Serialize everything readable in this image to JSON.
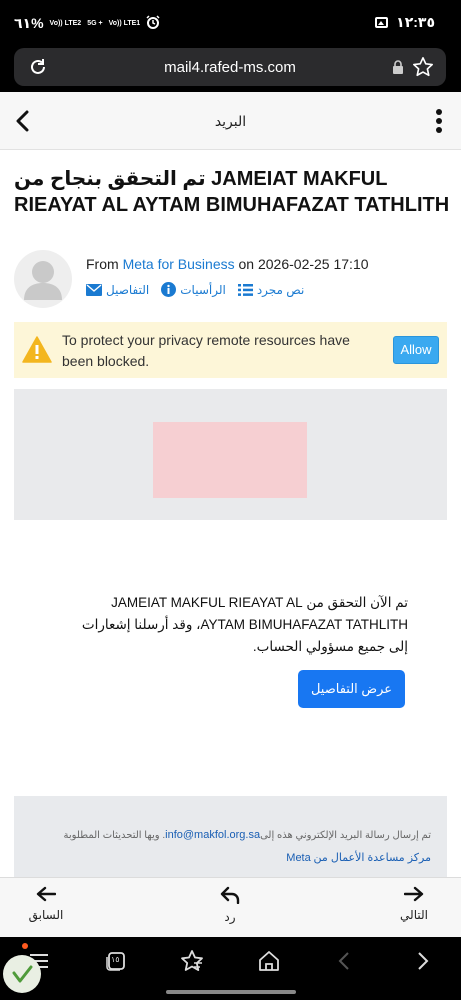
{
  "status_bar": {
    "battery": "٦١%",
    "net1": "Vo)) LTE2",
    "net2": "5G +",
    "net3": "Vo)) LTE1",
    "time": "١٢:٣٥"
  },
  "browser": {
    "url": "mail4.rafed-ms.com"
  },
  "header": {
    "title": "البريد"
  },
  "message": {
    "subject": "تم التحقق بنجاح من JAMEIAT MAKFUL RIEAYAT AL AYTAM BIMUHAFAZAT TATHLITH",
    "from_prefix": "From",
    "sender": "Meta for Business",
    "date_prefix": "on",
    "date": "2026-02-25 17:10",
    "links": {
      "plain_text": "نص مجرد",
      "headers": "الرأسيات",
      "details": "التفاصيل"
    }
  },
  "privacy_banner": {
    "text": "To protect your privacy remote resources have been blocked.",
    "allow_label": "Allow"
  },
  "body": {
    "line1": "تم الآن التحقق من JAMEIAT MAKFUL RIEAYAT AL",
    "line2": "AYTAM BIMUHAFAZAT TATHLITH، وقد أرسلنا إشعارات",
    "line3": "إلى جميع مسؤولي الحساب.",
    "cta_label": "عرض التفاصيل"
  },
  "footer": {
    "text_part1": ". ويها التحديثات المطلوبة",
    "email": "info@makfol.org.sa",
    "text_part2": "تم إرسال رسالة البريد الإلكتروني هذه إلى",
    "help_link": "مركز مساعدة الأعمال من",
    "brand": "Meta"
  },
  "actions": {
    "prev": "السابق",
    "reply": "رد",
    "next": "التالي"
  },
  "browser_nav": {
    "tabs_count": "١٥"
  },
  "colors": {
    "link": "#1a7ad1",
    "allow_button": "#3aa9f0",
    "cta_button": "#1877f2",
    "banner_bg": "#fdf6d8"
  }
}
